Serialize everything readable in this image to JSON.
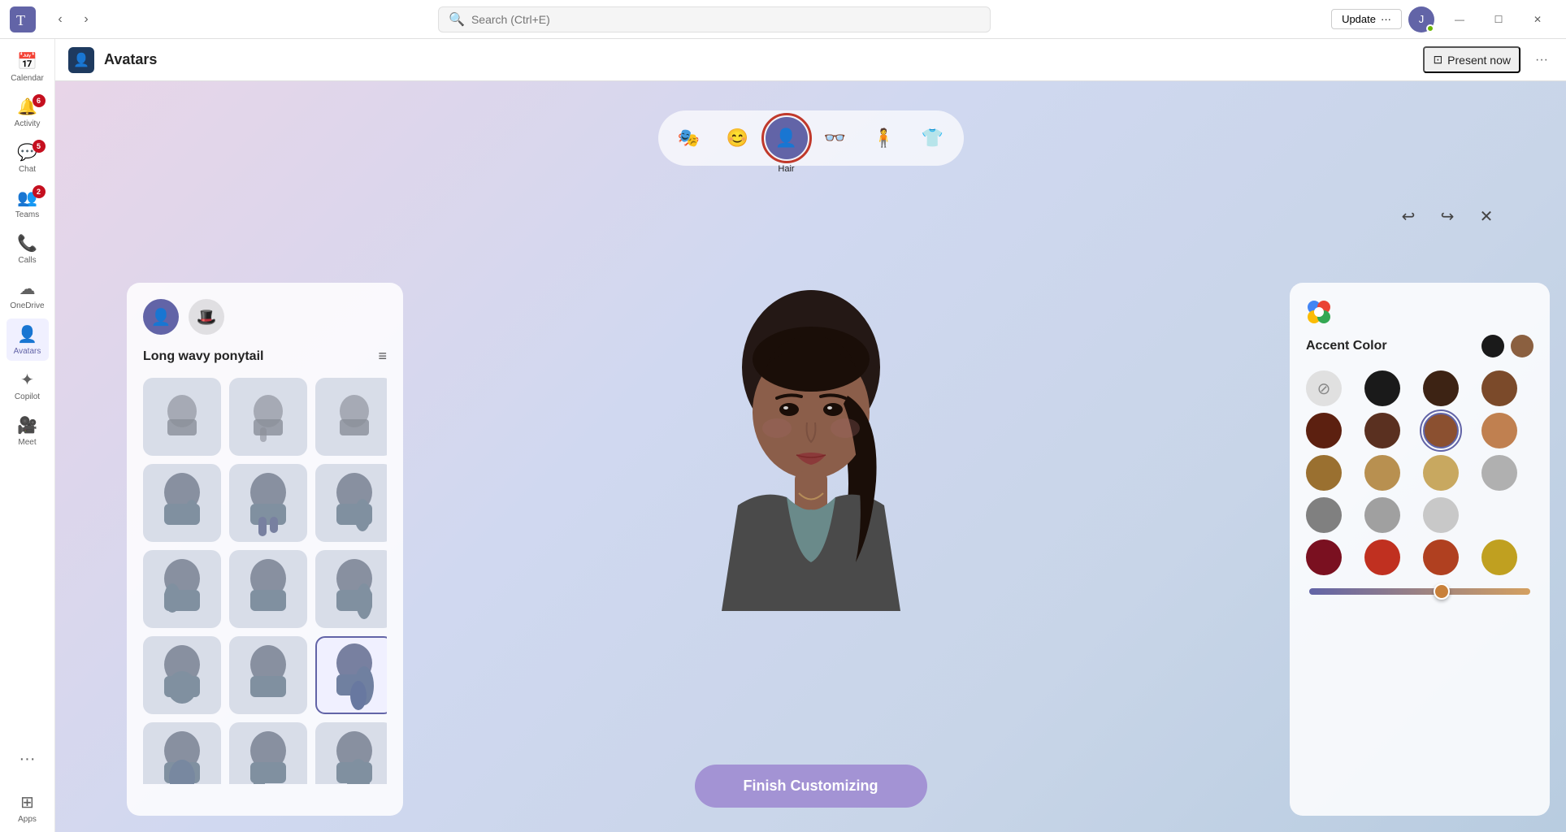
{
  "titlebar": {
    "search_placeholder": "Search (Ctrl+E)",
    "update_label": "Update",
    "update_ellipsis": "···",
    "minimize": "—",
    "maximize": "☐",
    "close": "✕"
  },
  "sidebar": {
    "items": [
      {
        "id": "calendar",
        "label": "Calendar",
        "icon": "📅",
        "badge": null
      },
      {
        "id": "activity",
        "label": "Activity",
        "icon": "🔔",
        "badge": "6"
      },
      {
        "id": "chat",
        "label": "Chat",
        "icon": "💬",
        "badge": "5"
      },
      {
        "id": "teams",
        "label": "Teams",
        "icon": "👥",
        "badge": "2"
      },
      {
        "id": "calls",
        "label": "Calls",
        "icon": "📞",
        "badge": null
      },
      {
        "id": "onedrive",
        "label": "OneDrive",
        "icon": "☁",
        "badge": null
      },
      {
        "id": "avatars",
        "label": "Avatars",
        "icon": "👤",
        "badge": null,
        "active": true
      },
      {
        "id": "copilot",
        "label": "Copilot",
        "icon": "✦",
        "badge": null
      },
      {
        "id": "meet",
        "label": "Meet",
        "icon": "🎥",
        "badge": null
      },
      {
        "id": "more",
        "label": "···",
        "icon": "···",
        "badge": null
      },
      {
        "id": "apps",
        "label": "Apps",
        "icon": "⊞",
        "badge": null
      }
    ]
  },
  "app_header": {
    "icon": "👤",
    "title": "Avatars",
    "present_label": "Present now",
    "more_icon": "···"
  },
  "tab_bar": {
    "tabs": [
      {
        "id": "preset",
        "icon": "🎭",
        "label": "",
        "active": false
      },
      {
        "id": "face",
        "icon": "😊",
        "label": "",
        "active": false
      },
      {
        "id": "hair",
        "icon": "👤",
        "label": "Hair",
        "active": true
      },
      {
        "id": "accessories",
        "icon": "👓",
        "label": "",
        "active": false
      },
      {
        "id": "body",
        "icon": "🧍",
        "label": "",
        "active": false
      },
      {
        "id": "clothing",
        "icon": "👕",
        "label": "",
        "active": false
      }
    ]
  },
  "left_panel": {
    "title": "Long wavy ponytail",
    "hair_items": [
      {
        "id": 1,
        "selected": false
      },
      {
        "id": 2,
        "selected": false
      },
      {
        "id": 3,
        "selected": false
      },
      {
        "id": 4,
        "selected": false
      },
      {
        "id": 5,
        "selected": false
      },
      {
        "id": 6,
        "selected": false
      },
      {
        "id": 7,
        "selected": false
      },
      {
        "id": 8,
        "selected": false
      },
      {
        "id": 9,
        "selected": true
      },
      {
        "id": 10,
        "selected": false
      },
      {
        "id": 11,
        "selected": false
      },
      {
        "id": 12,
        "selected": false
      }
    ]
  },
  "right_panel": {
    "accent_color_label": "Accent Color",
    "selected_colors": [
      "#1a1a1a",
      "#8b6040"
    ],
    "color_swatches": [
      {
        "id": "none",
        "color": null,
        "label": "none"
      },
      {
        "id": "black",
        "color": "#1a1a1a"
      },
      {
        "id": "darkbrown",
        "color": "#3d2314"
      },
      {
        "id": "brown",
        "color": "#7b4a2a"
      },
      {
        "id": "darkred",
        "color": "#5c2010"
      },
      {
        "id": "chocolatebrown",
        "color": "#5a3020"
      },
      {
        "id": "auburn",
        "color": "#8b5030",
        "selected": true
      },
      {
        "id": "lightbrown",
        "color": "#c08050"
      },
      {
        "id": "goldenbrown",
        "color": "#9a7030"
      },
      {
        "id": "darkblonde",
        "color": "#b89050"
      },
      {
        "id": "blonde",
        "color": "#c8a860"
      },
      {
        "id": "lightgrey",
        "color": "#b0b0b0"
      },
      {
        "id": "darkgrey",
        "color": "#808080"
      },
      {
        "id": "grey",
        "color": "#a0a0a0"
      },
      {
        "id": "silver",
        "color": "#c8c8c8"
      },
      {
        "id": "darkred2",
        "color": "#7a1020"
      },
      {
        "id": "red",
        "color": "#c03020"
      },
      {
        "id": "auburn2",
        "color": "#b04020"
      },
      {
        "id": "gold",
        "color": "#c0a020"
      }
    ],
    "slider_value": 60
  },
  "finish_button": {
    "label": "Finish Customizing"
  },
  "controls": {
    "undo": "↩",
    "redo": "↪",
    "close": "✕"
  }
}
